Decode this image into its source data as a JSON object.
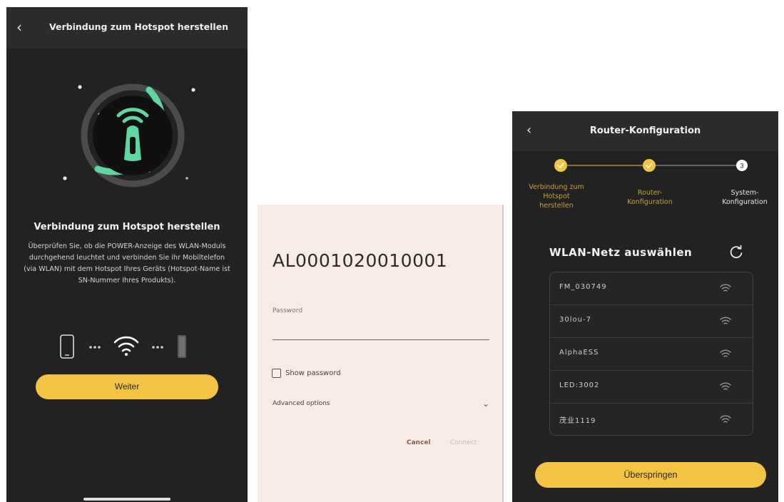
{
  "hotspot_screen": {
    "header": {
      "back_icon": "chevron-left-icon",
      "title": "Verbindung zum Hotspot herstellen"
    },
    "hero_icon": "router-signal-icon",
    "title": "Verbindung zum Hotspot herstellen",
    "description": "Überprüfen Sie, ob die POWER-Anzeige des WLAN-Moduls durchgehend leuchtet und verbinden Sie ihr Mobiltelefon (via WLAN) mit dem Hotspot Ihres Geräts (Hotspot-Name ist SN-Nummer Ihres Produkts).",
    "flow_icons": [
      "phone-icon",
      "wifi-icon",
      "device-icon"
    ],
    "button_label": "Weiter",
    "colors": {
      "accent": "#f3c443",
      "ring": "#5fd6a0",
      "background": "#222222"
    }
  },
  "wifi_dialog": {
    "ssid": "AL0001020010001",
    "password_label": "Password",
    "password_value": "",
    "show_password_label": "Show password",
    "show_password_checked": false,
    "advanced_options_label": "Advanced options",
    "cancel_label": "Cancel",
    "connect_label": "Connect"
  },
  "router_screen": {
    "header": {
      "back_icon": "chevron-left-icon",
      "title": "Router-Konfiguration"
    },
    "steps": [
      {
        "label_lines": [
          "Verbindung zum",
          "Hotspot",
          "herstellen"
        ],
        "state": "done"
      },
      {
        "label_lines": [
          "Router-",
          "Konfiguration"
        ],
        "state": "done"
      },
      {
        "number": "3",
        "label_lines": [
          "System-",
          "Konfiguration"
        ],
        "state": "pending"
      }
    ],
    "section_title": "WLAN-Netz auswählen",
    "refresh_icon": "refresh-icon",
    "networks": [
      {
        "name": "FM_030749"
      },
      {
        "name": "30lou-7"
      },
      {
        "name": "AlphaESS"
      },
      {
        "name": "LED:3002"
      },
      {
        "name": "茂业1119"
      }
    ],
    "skip_label": "Überspringen"
  }
}
